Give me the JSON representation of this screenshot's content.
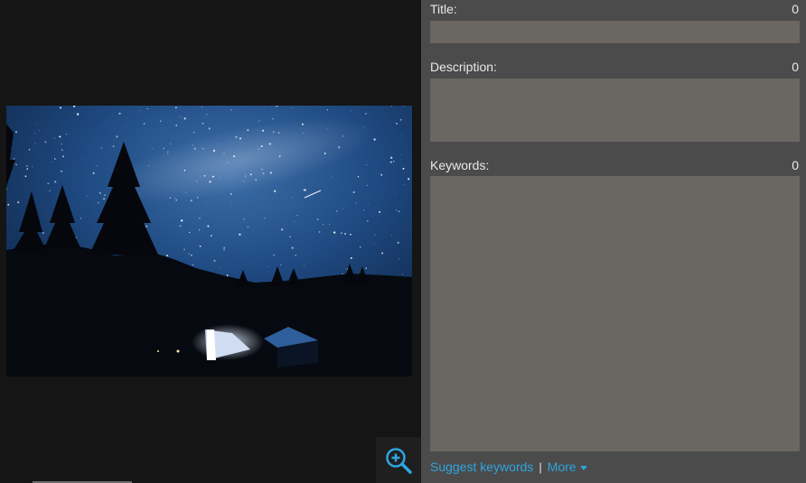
{
  "title_field": {
    "label": "Title:",
    "count": "0",
    "value": ""
  },
  "description_field": {
    "label": "Description:",
    "count": "0",
    "value": ""
  },
  "keywords_field": {
    "label": "Keywords:",
    "count": "0",
    "value": ""
  },
  "links": {
    "suggest": "Suggest keywords",
    "separator": "|",
    "more": "More"
  },
  "icons": {
    "zoom": "zoom-in-icon",
    "more_caret": "caret-down-icon"
  },
  "colors": {
    "accent": "#2ea6df",
    "field_bg": "#6a6661",
    "panel_bg": "#4b4b4b",
    "page_bg": "#151515"
  }
}
